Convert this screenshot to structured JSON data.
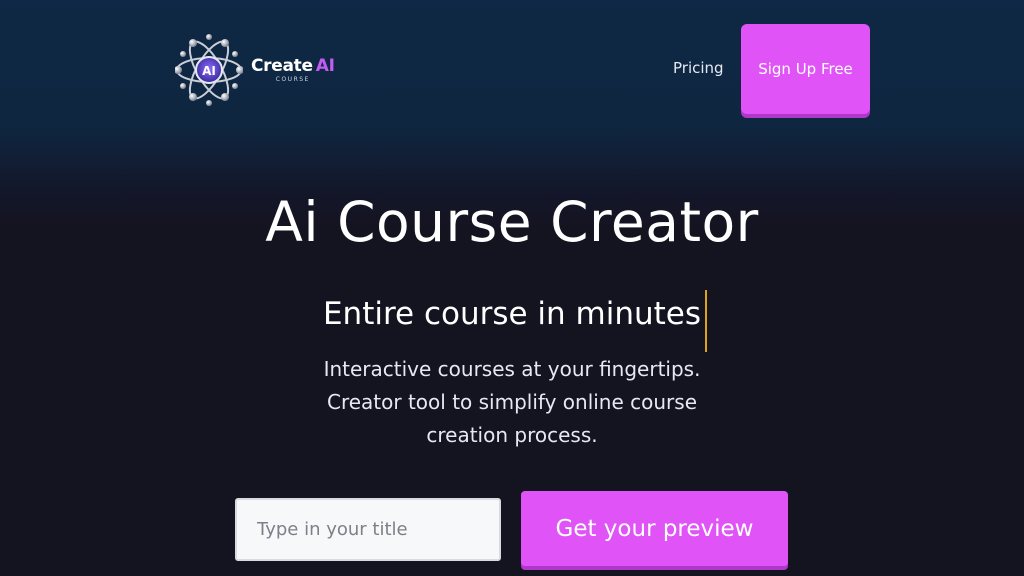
{
  "header": {
    "logo": {
      "word_main": "Create",
      "word_accent": "AI",
      "subtitle": "COURSE",
      "badge": "AI",
      "icon": "atom-icon"
    },
    "nav": {
      "pricing_label": "Pricing",
      "signup_label": "Sign Up Free"
    }
  },
  "hero": {
    "title": "Ai Course Creator",
    "typing_text": "Entire course in minutes",
    "description_lines": [
      "Interactive courses at your fingertips.",
      "Creator tool to simplify online course",
      "creation process."
    ]
  },
  "form": {
    "title_input": {
      "placeholder": "Type in your title",
      "value": ""
    },
    "preview_button_label": "Get your preview"
  },
  "colors": {
    "accent": "#e054f7",
    "accent_shadow": "#b037c9",
    "header_bg": "#0e2845",
    "page_bg": "#141320",
    "cursor": "#e0a21f"
  }
}
